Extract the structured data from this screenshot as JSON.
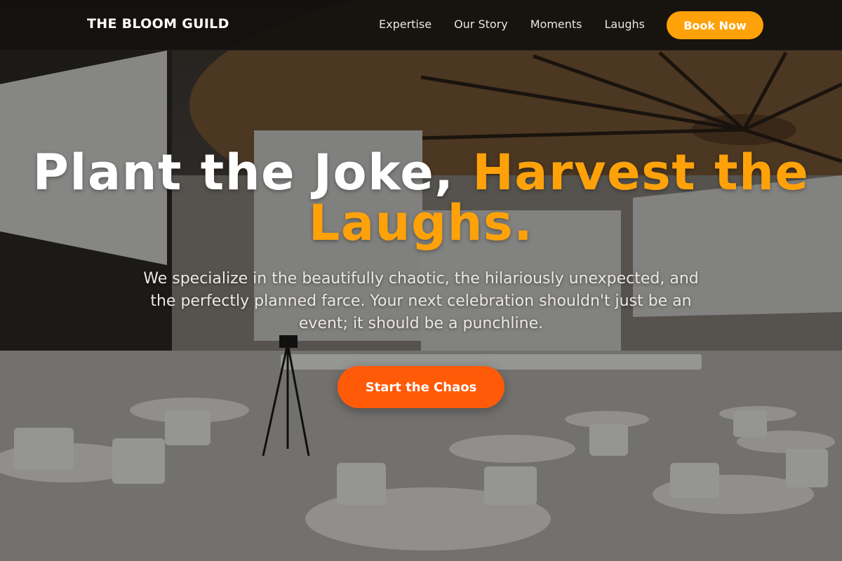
{
  "nav": {
    "brand": "THE BLOOM GUILD",
    "links": [
      {
        "label": "Expertise"
      },
      {
        "label": "Our Story"
      },
      {
        "label": "Moments"
      },
      {
        "label": "Laughs"
      }
    ],
    "cta_label": "Book Now"
  },
  "hero": {
    "headline_part1": "Plant the Joke, ",
    "headline_part2": "Harvest the Laughs.",
    "subtitle": "We specialize in the beautifully chaotic, the hilariously unexpected, and the perfectly planned farce. Your next celebration shouldn't just be an event; it should be a punchline.",
    "cta_label": "Start the Chaos"
  },
  "colors": {
    "accent_orange": "#ffa20a",
    "cta_orange": "#ff5a08",
    "nav_background": "#12100e"
  }
}
